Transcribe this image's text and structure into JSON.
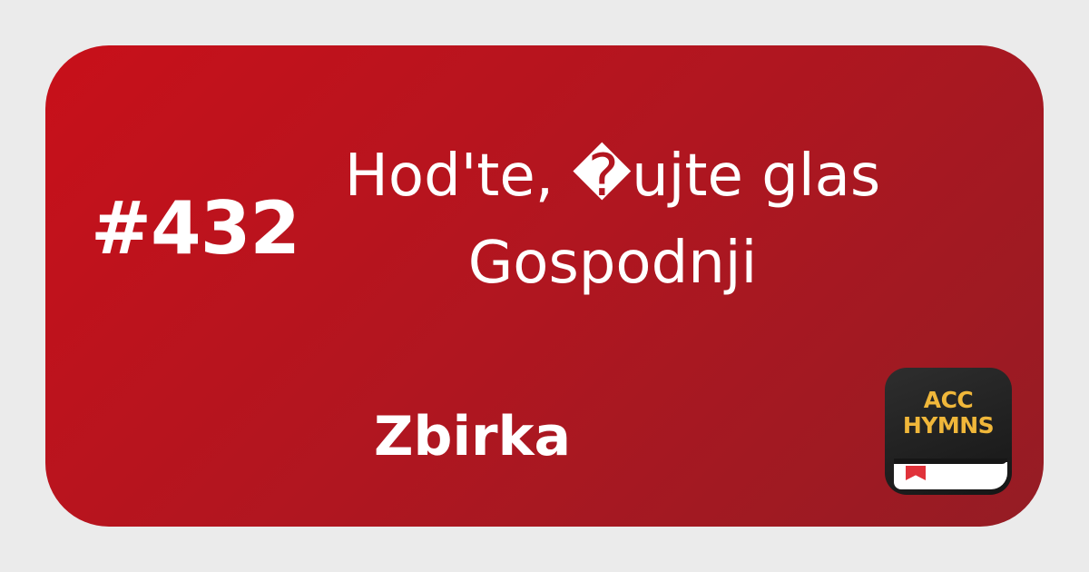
{
  "hymn": {
    "number": "#432",
    "title_line1": "Hod'te, �ujte glas",
    "title_line2": "Gospodnji",
    "collection": "Zbirka"
  },
  "logo": {
    "line1": "ACC",
    "line2": "HYMNS",
    "icon": "hymn-book-icon"
  },
  "colors": {
    "background": "#ebebeb",
    "card_start": "#c8101a",
    "card_end": "#951c24",
    "logo_bg": "#1c1c1c",
    "logo_text": "#f0b73a",
    "bookmark": "#e0323a"
  }
}
